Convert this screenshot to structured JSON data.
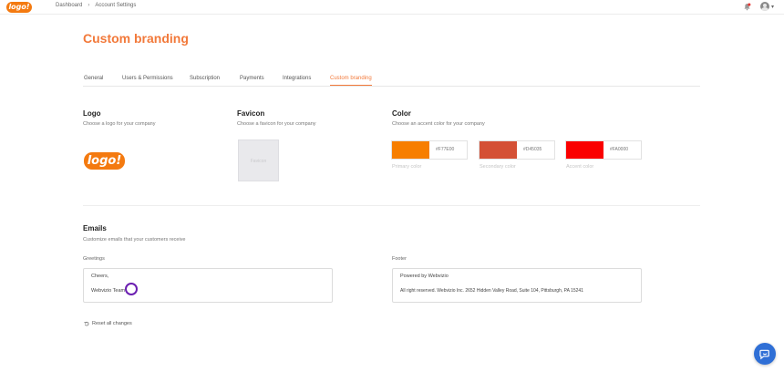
{
  "topbar": {
    "logo_text": "logo!",
    "breadcrumb": [
      "Dashboard",
      "Account Settings"
    ],
    "breadcrumb_sep": "›"
  },
  "page": {
    "title": "Custom branding"
  },
  "tabs": [
    {
      "label": "General"
    },
    {
      "label": "Users & Permissions"
    },
    {
      "label": "Subscription"
    },
    {
      "label": "Payments"
    },
    {
      "label": "Integrations"
    },
    {
      "label": "Custom branding",
      "active": true
    }
  ],
  "logo_section": {
    "title": "Logo",
    "subtitle": "Choose a logo for your company",
    "logo_text": "logo!"
  },
  "favicon_section": {
    "title": "Favicon",
    "subtitle": "Choose a favicon for your company",
    "placeholder": "Favicon"
  },
  "color_section": {
    "title": "Color",
    "subtitle": "Choose an accent color for your company",
    "colors": [
      {
        "label": "Primary color",
        "hex": "#F77E00"
      },
      {
        "label": "Secondary color",
        "hex": "#D45035"
      },
      {
        "label": "Accent color",
        "hex": "#FA0000"
      }
    ]
  },
  "emails_section": {
    "title": "Emails",
    "subtitle": "Customize emails that your customers receive",
    "greetings": {
      "label": "Greetings",
      "lines": [
        "Cheers,",
        "Webvizio Team"
      ]
    },
    "footer": {
      "label": "Footer",
      "lines": [
        "Powered by Webvizio",
        "All right reserved. Webvizio Inc. 2652 Hidden Valley Road, Suite 104, Pittsburgh, PA 15241"
      ]
    }
  },
  "actions": {
    "reset_label": "Reset all changes"
  },
  "colors": {
    "accent": "#f2793a",
    "brand": "#f47a10",
    "chat": "#2f6fd6",
    "cursor": "#6b1fb1"
  }
}
